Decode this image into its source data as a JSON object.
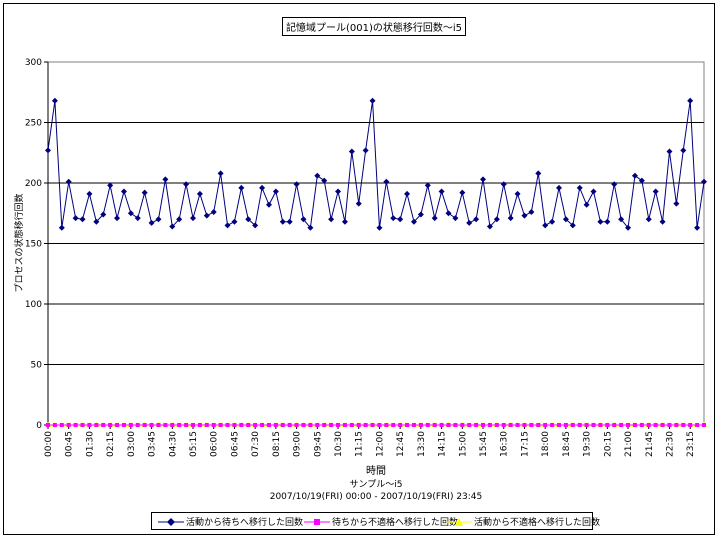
{
  "chart_data": {
    "type": "line",
    "title": "記憶域プール(001)の状態移行回数～i5",
    "ylabel": "プロセスの状態移行回数",
    "xlabel": "時間",
    "subtitle1": "サンプル～i5",
    "subtitle2": "2007/10/19(FRI) 00:00 - 2007/10/19(FRI) 23:45",
    "ylim": [
      0,
      300
    ],
    "yticks": [
      "0",
      "50",
      "100",
      "150",
      "200",
      "250",
      "300"
    ],
    "x_tick_labels": [
      "00:00",
      "00:45",
      "01:30",
      "02:15",
      "03:00",
      "03:45",
      "04:30",
      "05:15",
      "06:00",
      "06:45",
      "07:30",
      "08:15",
      "09:00",
      "09:45",
      "10:30",
      "11:15",
      "12:00",
      "12:45",
      "13:30",
      "14:15",
      "15:00",
      "15:45",
      "16:30",
      "17:15",
      "18:00",
      "18:45",
      "19:30",
      "20:15",
      "21:00",
      "21:45",
      "22:30",
      "23:15"
    ],
    "grid": true,
    "legend_position": "bottom",
    "series": [
      {
        "name": "活動から待ちへ移行した回数",
        "color": "#000080",
        "marker": "diamond",
        "values": [
          227,
          268,
          163,
          201,
          171,
          170,
          191,
          168,
          174,
          198,
          171,
          193,
          175,
          171,
          192,
          167,
          170,
          203,
          164,
          170,
          199,
          171,
          191,
          173,
          176,
          208,
          165,
          168,
          196,
          170,
          165,
          196,
          182,
          193,
          168,
          168,
          199,
          170,
          163,
          206,
          202,
          170,
          193,
          168,
          226,
          183,
          227,
          268,
          163,
          201,
          171,
          170,
          191,
          168,
          174,
          198,
          171,
          193,
          175,
          171,
          192,
          167,
          170,
          203,
          164,
          170,
          199,
          171,
          191,
          173,
          176,
          208,
          165,
          168,
          196,
          170,
          165,
          196,
          182,
          193,
          168,
          168,
          199,
          170,
          163,
          206,
          202,
          170,
          193,
          168,
          226,
          183,
          227,
          268,
          163,
          201
        ]
      },
      {
        "name": "待ちから不適格へ移行した回数",
        "color": "#FF00FF",
        "marker": "square",
        "values": [
          0,
          0,
          0,
          0,
          0,
          0,
          0,
          0,
          0,
          0,
          0,
          0,
          0,
          0,
          0,
          0,
          0,
          0,
          0,
          0,
          0,
          0,
          0,
          0,
          0,
          0,
          0,
          0,
          0,
          0,
          0,
          0,
          0,
          0,
          0,
          0,
          0,
          0,
          0,
          0,
          0,
          0,
          0,
          0,
          0,
          0,
          0,
          0,
          0,
          0,
          0,
          0,
          0,
          0,
          0,
          0,
          0,
          0,
          0,
          0,
          0,
          0,
          0,
          0,
          0,
          0,
          0,
          0,
          0,
          0,
          0,
          0,
          0,
          0,
          0,
          0,
          0,
          0,
          0,
          0,
          0,
          0,
          0,
          0,
          0,
          0,
          0,
          0,
          0,
          0,
          0,
          0,
          0,
          0,
          0,
          0
        ]
      },
      {
        "name": "活動から不適格へ移行した回数",
        "color": "#FFFF00",
        "marker": "triangle",
        "values": [
          0,
          0,
          0,
          0,
          0,
          0,
          0,
          0,
          0,
          0,
          0,
          0,
          0,
          0,
          0,
          0,
          0,
          0,
          0,
          0,
          0,
          0,
          0,
          0,
          0,
          0,
          0,
          0,
          0,
          0,
          0,
          0,
          0,
          0,
          0,
          0,
          0,
          0,
          0,
          0,
          0,
          0,
          0,
          0,
          0,
          0,
          0,
          0,
          0,
          0,
          0,
          0,
          0,
          0,
          0,
          0,
          0,
          0,
          0,
          0,
          0,
          0,
          0,
          0,
          0,
          0,
          0,
          0,
          0,
          0,
          0,
          0,
          0,
          0,
          0,
          0,
          0,
          0,
          0,
          0,
          0,
          0,
          0,
          0,
          0,
          0,
          0,
          0,
          0,
          0,
          0,
          0,
          0,
          0,
          0,
          0
        ]
      }
    ]
  }
}
